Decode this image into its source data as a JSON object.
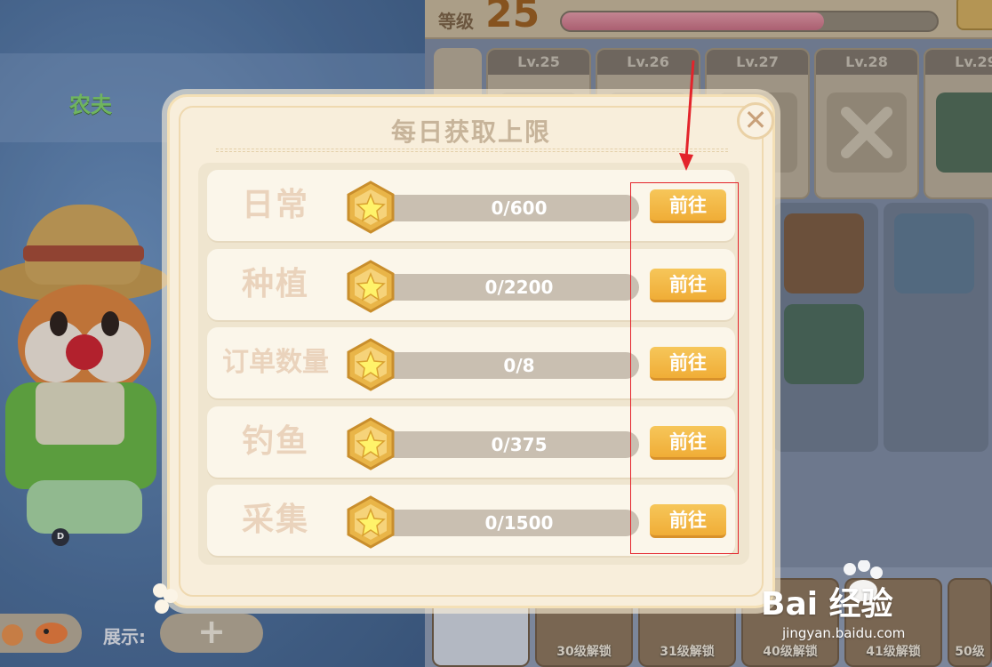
{
  "background": {
    "role_title": "农夫",
    "level_label": "等级",
    "level_value": "25",
    "level_tabs": [
      "Lv.25",
      "Lv.26",
      "Lv.27",
      "Lv.28",
      "Lv.29"
    ],
    "unlock_cards": [
      "30级解锁",
      "31级解锁",
      "40级解锁",
      "41级解锁",
      "50级"
    ],
    "show_label": "展示:",
    "show_plus": "+",
    "char_badge": "D"
  },
  "dialog": {
    "title": "每日获取上限",
    "close_symbol": "✕",
    "rows": [
      {
        "label": "日常",
        "progress": "0/600",
        "button": "前往"
      },
      {
        "label": "种植",
        "progress": "0/2200",
        "button": "前往"
      },
      {
        "label": "订单数量",
        "progress": "0/8",
        "button": "前往"
      },
      {
        "label": "钓鱼",
        "progress": "0/375",
        "button": "前往"
      },
      {
        "label": "采集",
        "progress": "0/1500",
        "button": "前往"
      }
    ]
  },
  "watermark": {
    "brand": "Bai  经验",
    "url": "jingyan.baidu.com"
  },
  "colors": {
    "accent_button": "#f0ad37",
    "annotation": "#e3242b",
    "label_text": "#ead3bc"
  }
}
